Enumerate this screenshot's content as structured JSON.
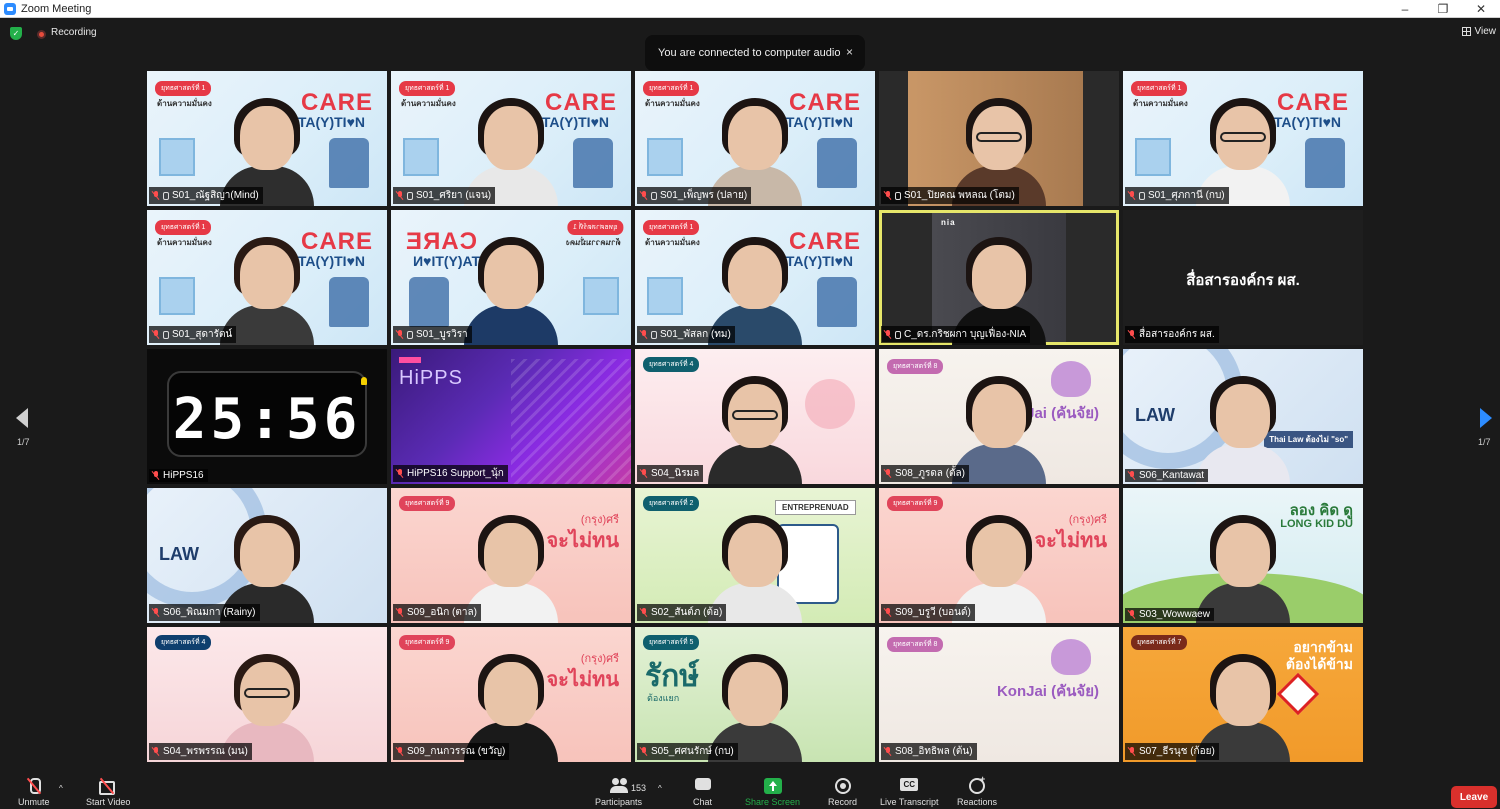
{
  "window": {
    "title": "Zoom Meeting"
  },
  "topbar": {
    "recording_label": "Recording",
    "view_label": "View"
  },
  "toast": {
    "message": "You are connected to computer audio",
    "close": "×"
  },
  "navigation": {
    "page_left": "1/7",
    "page_right": "1/7"
  },
  "tiles": [
    {
      "name": "S01_ณัฐสิญา(Mind)",
      "bg": "care",
      "hair": "#1c1412",
      "shirt": "#2e2e2e"
    },
    {
      "name": "S01_ศริยา (แจน)",
      "bg": "care",
      "hair": "#1c1412",
      "shirt": "#e8e8e8"
    },
    {
      "name": "S01_เพ็ญพร (ปลาย)",
      "bg": "care",
      "hair": "#1c1412",
      "shirt": "#c8b8a8"
    },
    {
      "name": "S01_ปิยคณ พหลณ (โตม)",
      "bg": "office",
      "hair": "#1c1412",
      "shirt": "#5a3a2a"
    },
    {
      "name": "S01_ศุภกานี (กบ)",
      "bg": "care",
      "hair": "#1c1412",
      "shirt": "#f2f2f2"
    },
    {
      "name": "S01_สุดารัตน์",
      "bg": "care",
      "hair": "#2a1a14",
      "shirt": "#3a3a3a"
    },
    {
      "name": "S01_บูรวิรา",
      "bg": "care-mirror",
      "hair": "#1c1412",
      "shirt": "#1d3a66"
    },
    {
      "name": "S01_พัสลก (ทม)",
      "bg": "care",
      "hair": "#1c1412",
      "shirt": "#2a4a6a"
    },
    {
      "name": "C_ดร.กริชผกา บุญเฟื่อง-NIA",
      "bg": "nia",
      "hair": "#1c1412",
      "shirt": "#111111",
      "speaking": true,
      "pinned": true
    },
    {
      "name": "สื่อสารองค์กร ผส.",
      "bg": "black",
      "org": "สื่อสารองค์กร ผส."
    },
    {
      "name": "HiPPS16",
      "bg": "clock",
      "clock": "25:56"
    },
    {
      "name": "HiPPS16 Support_นุ้ก",
      "bg": "hipps",
      "logo": "HiPPS"
    },
    {
      "name": "S04_นิรมล",
      "bg": "pink",
      "hair": "#1c1412",
      "shirt": "#2a2a2a"
    },
    {
      "name": "S08_ภูรดล (ตั้ล)",
      "bg": "konjai",
      "hair": "#1c1412",
      "shirt": "#5a6a8a",
      "brand": "KonJai (คันจัย)"
    },
    {
      "name": "S06_Kantawat",
      "bg": "law",
      "hair": "#1c1412",
      "shirt": "#e8e8f0",
      "law": "LAW",
      "slogan": "Thai Law ต้องไม่ \"so\""
    },
    {
      "name": "S06_พิณมกา (Rainy)",
      "bg": "law",
      "hair": "#2a1a14",
      "shirt": "#2a2a2a",
      "law": "LAW",
      "slogan": ""
    },
    {
      "name": "S09_อนิก (ตาล)",
      "bg": "salmon",
      "hair": "#1c1412",
      "shirt": "#f2f2f2",
      "krung": "(กรุง)ศรี",
      "krung2": "จะไม่ทน"
    },
    {
      "name": "S02_สันต์ภ (ต้อ)",
      "bg": "green",
      "hair": "#1c1412",
      "shirt": "#e8e8e8",
      "ent": "ENTREPRENUAD"
    },
    {
      "name": "S09_บรูวี (บอนด์)",
      "bg": "salmon",
      "hair": "#1c1412",
      "shirt": "#f2f2f2",
      "krung": "(กรุง)ศรี",
      "krung2": "จะไม่ทน"
    },
    {
      "name": "S03_Wowwaew",
      "bg": "kid",
      "hair": "#1c1412",
      "shirt": "#3a3a3a",
      "kid": "ลอง คิด ดู",
      "kid2": "LONG KID DU"
    },
    {
      "name": "S04_พรพรรณ (มน)",
      "bg": "pink2",
      "hair": "#2a1a14",
      "shirt": "#e8b8c0"
    },
    {
      "name": "S09_กนกวรรณ (ขวัญ)",
      "bg": "salmon",
      "hair": "#1c1412",
      "shirt": "#1a1a1a",
      "krung": "(กรุง)ศรี",
      "krung2": "จะไม่ทน"
    },
    {
      "name": "S05_ศศนรักษ์ (กบ)",
      "bg": "green2",
      "hair": "#1c1412",
      "shirt": "#3a3a3a",
      "rak": "รักษ์",
      "rak2": "ต้องแยก"
    },
    {
      "name": "S08_อิทธิพล (ต้น)",
      "bg": "konjai",
      "hair": "#1c1412",
      "shirt": "#5a6a8a",
      "brand": "KonJai (คันจัย)",
      "empty": true
    },
    {
      "name": "S07_ธีรนุช (ก้อย)",
      "bg": "orange",
      "hair": "#1c1412",
      "shirt": "#3a3a3a",
      "or1": "อยากข้าม",
      "or2": "ต้องได้ข้าม"
    }
  ],
  "care": {
    "tag": "ยุทธศาสตร์ที่ 1",
    "sub": "ด้านความมั่นคง",
    "word": "CARE",
    "word2": "STA(Y)TI♥N"
  },
  "toolbar": {
    "unmute": "Unmute",
    "start_video": "Start Video",
    "participants": "Participants",
    "participant_count": "153",
    "chat": "Chat",
    "share_screen": "Share Screen",
    "record": "Record",
    "live_transcript": "Live Transcript",
    "reactions": "Reactions",
    "leave": "Leave"
  },
  "colors": {
    "leave": "#d9302c",
    "share": "#23b04a",
    "speaking": "#e6e66a",
    "accent": "#2d8cff"
  }
}
